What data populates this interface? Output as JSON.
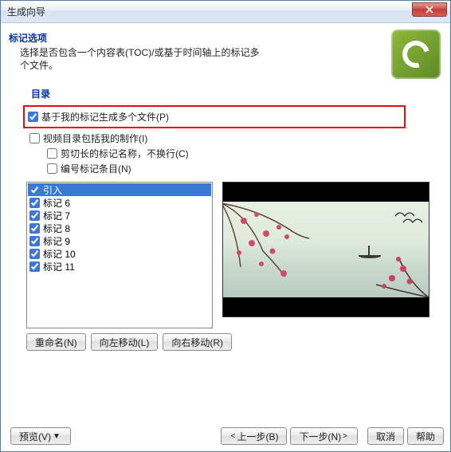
{
  "window": {
    "title": "生成向导"
  },
  "header": {
    "title": "标记选项",
    "description": "选择是否包含一个内容表(TOC)/或基于时间轴上的标记多个文件。"
  },
  "section": {
    "directory_label": "目录"
  },
  "options": {
    "generate_multi": "基于我的标记生成多个文件(P)",
    "include_production": "视频目录包括我的制作(I)",
    "trim_names": "剪切长的标记名称，不换行(C)",
    "number_entries": "编号标记条目(N)"
  },
  "markers": [
    {
      "label": "引入",
      "checked": true,
      "selected": true
    },
    {
      "label": "标记 6",
      "checked": true,
      "selected": false
    },
    {
      "label": "标记 7",
      "checked": true,
      "selected": false
    },
    {
      "label": "标记 8",
      "checked": true,
      "selected": false
    },
    {
      "label": "标记 9",
      "checked": true,
      "selected": false
    },
    {
      "label": "标记 10",
      "checked": true,
      "selected": false
    },
    {
      "label": "标记 11",
      "checked": true,
      "selected": false
    }
  ],
  "list_buttons": {
    "rename": "重命名(N)",
    "move_left": "向左移动(L)",
    "move_right": "向右移动(R)"
  },
  "footer": {
    "preview": "预览(V)",
    "back": "上一步(B)",
    "next": "下一步(N)",
    "cancel": "取消",
    "help": "帮助"
  }
}
